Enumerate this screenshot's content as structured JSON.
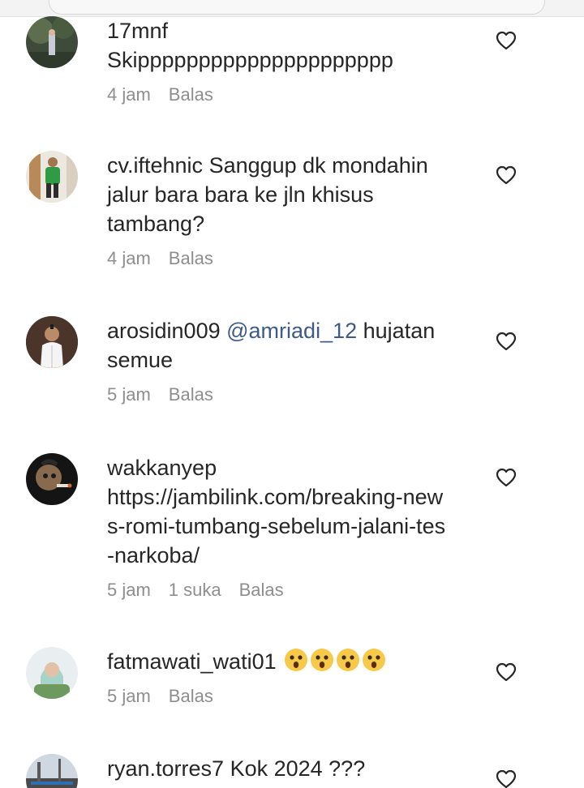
{
  "comments": [
    {
      "username": "17mnf",
      "text": "Skippppppppppppppppppppp",
      "time": "4 jam",
      "likes": "",
      "reply_label": "Balas"
    },
    {
      "username": "cv.iftehnic",
      "text": "Sanggup dk mondahin jalur bara bara ke jln khisus tambang?",
      "time": "4 jam",
      "likes": "",
      "reply_label": "Balas"
    },
    {
      "username": "arosidin009",
      "mention": "@amriadi_12",
      "text": "hujatan semue",
      "time": "5 jam",
      "likes": "",
      "reply_label": "Balas"
    },
    {
      "username": "wakkanyep",
      "text": "https://jambilink.com/breaking-news-romi-tumbang-sebelum-jalani-tes-narkoba/",
      "time": "5 jam",
      "likes": "1 suka",
      "reply_label": "Balas"
    },
    {
      "username": "fatmawati_wati01",
      "text": "",
      "emojis": [
        "astonished-face",
        "astonished-face",
        "astonished-face",
        "astonished-face"
      ],
      "time": "5 jam",
      "likes": "",
      "reply_label": "Balas"
    },
    {
      "username": "ryan.torres7",
      "text": "Kok 2024 ???",
      "time": "",
      "likes": "",
      "reply_label": ""
    }
  ],
  "icons": {
    "like": "heart-outline-icon",
    "emoji": "astonished-face-emoji"
  },
  "colors": {
    "text": "#262626",
    "meta": "#8e8e8e",
    "mention": "#3d5a8a",
    "emoji_face": "#f7c948"
  }
}
